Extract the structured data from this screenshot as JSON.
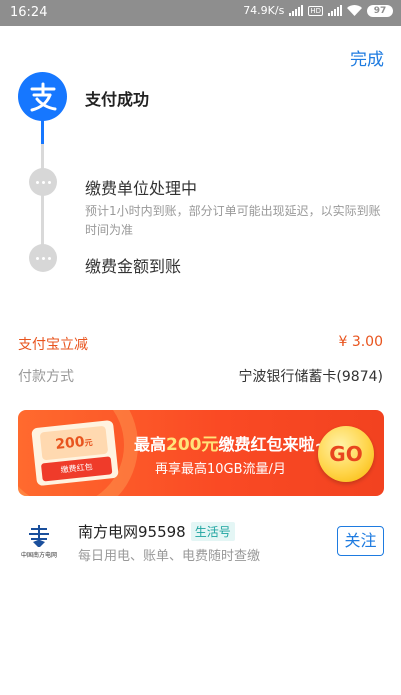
{
  "status_bar": {
    "time": "16:24",
    "network_speed": "74.9K/s",
    "hd_label": "HD",
    "battery": "97"
  },
  "header": {
    "done_label": "完成"
  },
  "timeline": {
    "steps": [
      {
        "title": "支付成功"
      },
      {
        "title": "缴费单位处理中",
        "subtitle": "预计1小时内到账，部分订单可能出现延迟，以实际到账时间为准"
      },
      {
        "title": "缴费金额到账"
      }
    ]
  },
  "details": {
    "discount_label": "支付宝立减",
    "discount_value": "¥ 3.00",
    "payment_method_label": "付款方式",
    "payment_method_value": "宁波银行储蓄卡(9874)"
  },
  "banner": {
    "coupon_amount": "200",
    "coupon_unit": "元",
    "coupon_tag": "缴费红包",
    "title_prefix": "最高",
    "title_highlight": "200元",
    "title_suffix": "缴费红包来啦~",
    "subtitle": "再享最高10GB流量/月",
    "go_label": "GO"
  },
  "service": {
    "logo_text": "中国南方电网",
    "name": "南方电网95598",
    "tag": "生活号",
    "description": "每日用电、账单、电费随时查缴",
    "follow_label": "关注"
  },
  "colors": {
    "accent_blue": "#1677ff",
    "discount_red": "#e8541e",
    "link_blue": "#1e7be0"
  }
}
